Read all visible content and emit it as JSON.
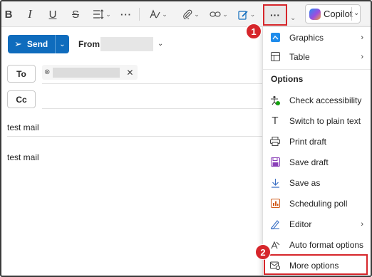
{
  "toolbar": {
    "bold": "B",
    "italic": "I",
    "underline": "U",
    "strikethrough": "S",
    "more": "···",
    "copilot_label": "Copilot",
    "icons": [
      "bold-icon",
      "italic-icon",
      "underline-icon",
      "strikethrough-icon",
      "paragraph-spacing-icon",
      "ellipsis-icon",
      "styles-icon",
      "attach-icon",
      "link-icon",
      "signature-icon",
      "more-options-icon",
      "copilot-icon"
    ]
  },
  "compose": {
    "send_label": "Send",
    "from_label": "From:",
    "to_label": "To",
    "cc_label": "Cc",
    "subject": "test mail",
    "body": "test mail"
  },
  "menu": {
    "options_heading": "Options",
    "items": [
      {
        "label": "Graphics",
        "icon": "graphics-icon",
        "submenu": true
      },
      {
        "label": "Table",
        "icon": "table-icon",
        "submenu": true
      },
      {
        "label": "Check accessibility",
        "icon": "accessibility-icon",
        "submenu": false
      },
      {
        "label": "Switch to plain text",
        "icon": "plain-text-icon",
        "submenu": false
      },
      {
        "label": "Print draft",
        "icon": "printer-icon",
        "submenu": false
      },
      {
        "label": "Save draft",
        "icon": "save-icon",
        "submenu": false
      },
      {
        "label": "Save as",
        "icon": "download-icon",
        "submenu": false
      },
      {
        "label": "Scheduling poll",
        "icon": "poll-icon",
        "submenu": false
      },
      {
        "label": "Editor",
        "icon": "editor-icon",
        "submenu": true
      },
      {
        "label": "Auto format options",
        "icon": "auto-format-icon",
        "submenu": false
      },
      {
        "label": "More options",
        "icon": "mail-settings-icon",
        "submenu": false
      }
    ]
  },
  "annotations": {
    "step1": "1",
    "step2": "2"
  },
  "colors": {
    "accent": "#0f6cbd",
    "annotation_red": "#d6262b"
  }
}
